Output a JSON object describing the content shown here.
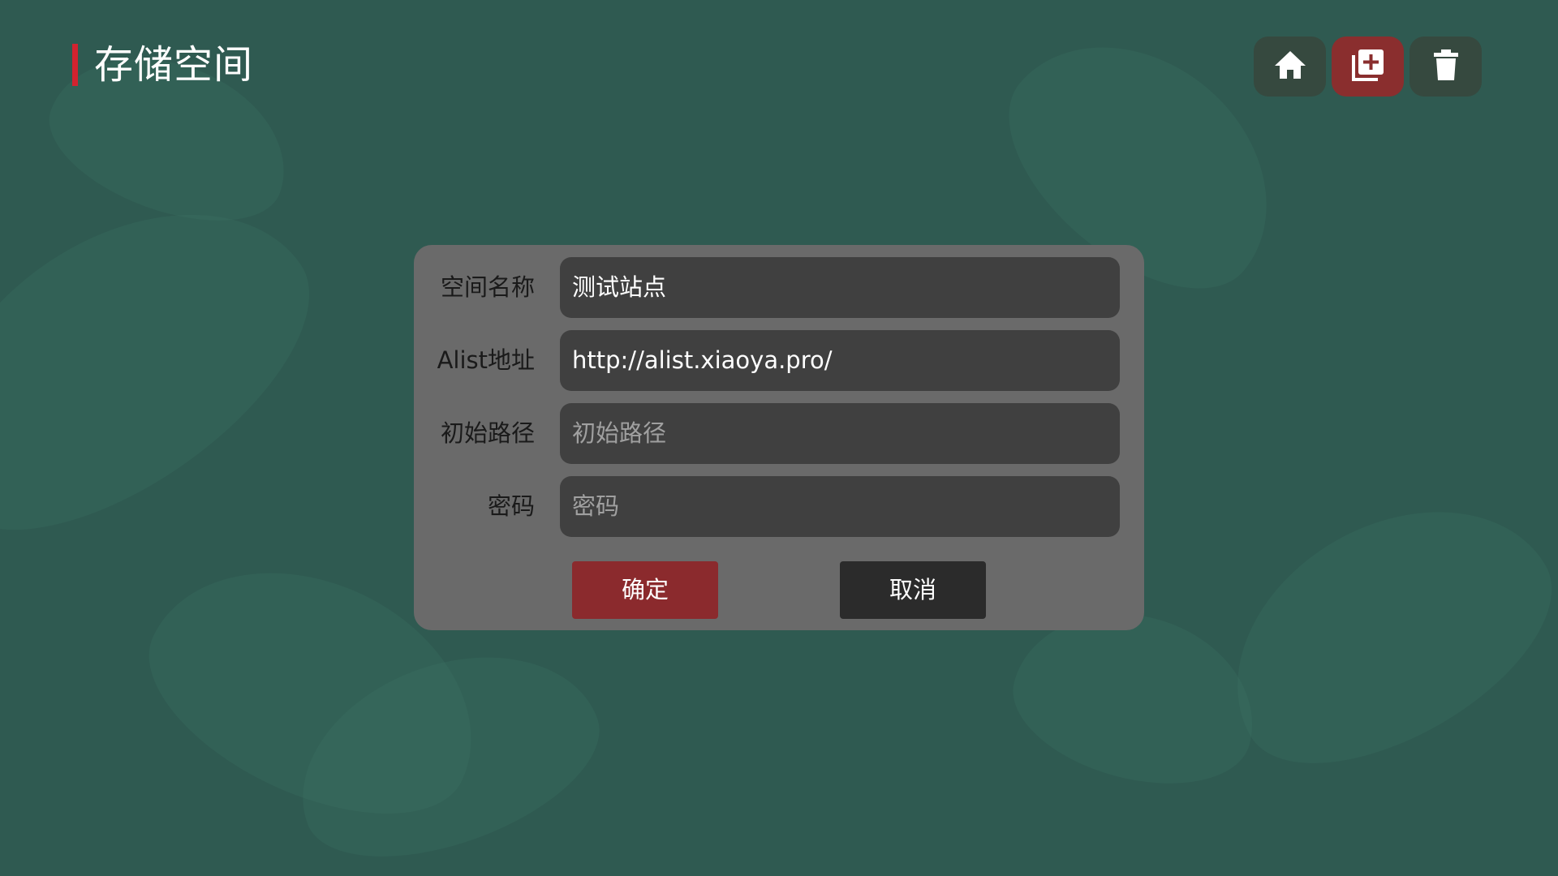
{
  "header": {
    "title": "存储空间",
    "accent_color": "#d3232f"
  },
  "toolbar": {
    "buttons": [
      {
        "icon": "home-icon",
        "active": false
      },
      {
        "icon": "add-library-icon",
        "active": true
      },
      {
        "icon": "trash-icon",
        "active": false
      }
    ]
  },
  "form": {
    "fields": [
      {
        "label": "空间名称",
        "value": "测试站点",
        "placeholder": ""
      },
      {
        "label": "Alist地址",
        "value": "http://alist.xiaoya.pro/",
        "placeholder": ""
      },
      {
        "label": "初始路径",
        "value": "",
        "placeholder": "初始路径"
      },
      {
        "label": "密码",
        "value": "",
        "placeholder": "密码"
      }
    ],
    "confirm_label": "确定",
    "cancel_label": "取消"
  },
  "colors": {
    "background": "#2f5a51",
    "dialog": "#6a6a6a",
    "field": "#404040",
    "confirm": "#8b2a2d",
    "cancel": "#2b2b2b",
    "active_tool": "#8a2e2e"
  }
}
